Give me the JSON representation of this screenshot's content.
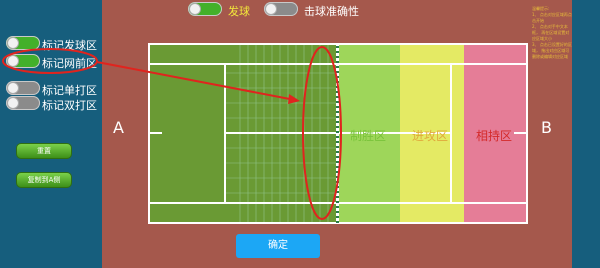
{
  "top": {
    "serve_label": "发球",
    "accuracy_label": "击球准确性"
  },
  "toggles": [
    {
      "label": "标记发球区",
      "state": "on"
    },
    {
      "label": "标记网前区",
      "state": "on"
    },
    {
      "label": "标记单打区",
      "state": "off"
    },
    {
      "label": "标记双打区",
      "state": "off"
    }
  ],
  "buttons": {
    "reset": "重置",
    "copy_to_a": "复制到A侧",
    "confirm": "确定"
  },
  "court": {
    "side_a": "A",
    "side_b": "B",
    "zones": [
      {
        "label": "制胜区",
        "color": "#8fd640",
        "label_color": "#79c33a"
      },
      {
        "label": "进攻区",
        "color": "#e6ea5c",
        "label_color": "#e0a93c"
      },
      {
        "label": "相持区",
        "color": "#e86a8c",
        "label_color": "#d42a2a"
      }
    ]
  },
  "notes": {
    "title": "温馨提示:",
    "lines": [
      "1、 点击对应区域再点击开始",
      "2、 点击对手中文本框， 再在区域设置对应区域大小",
      "3、 点击已设置好的区域， 拖出对应区域可删除或编辑对应区域"
    ]
  },
  "colors": {
    "background": "#165e7d",
    "court_surround": "#a5584c",
    "grass": "#6a9a34",
    "annotation": "#e0241e"
  }
}
